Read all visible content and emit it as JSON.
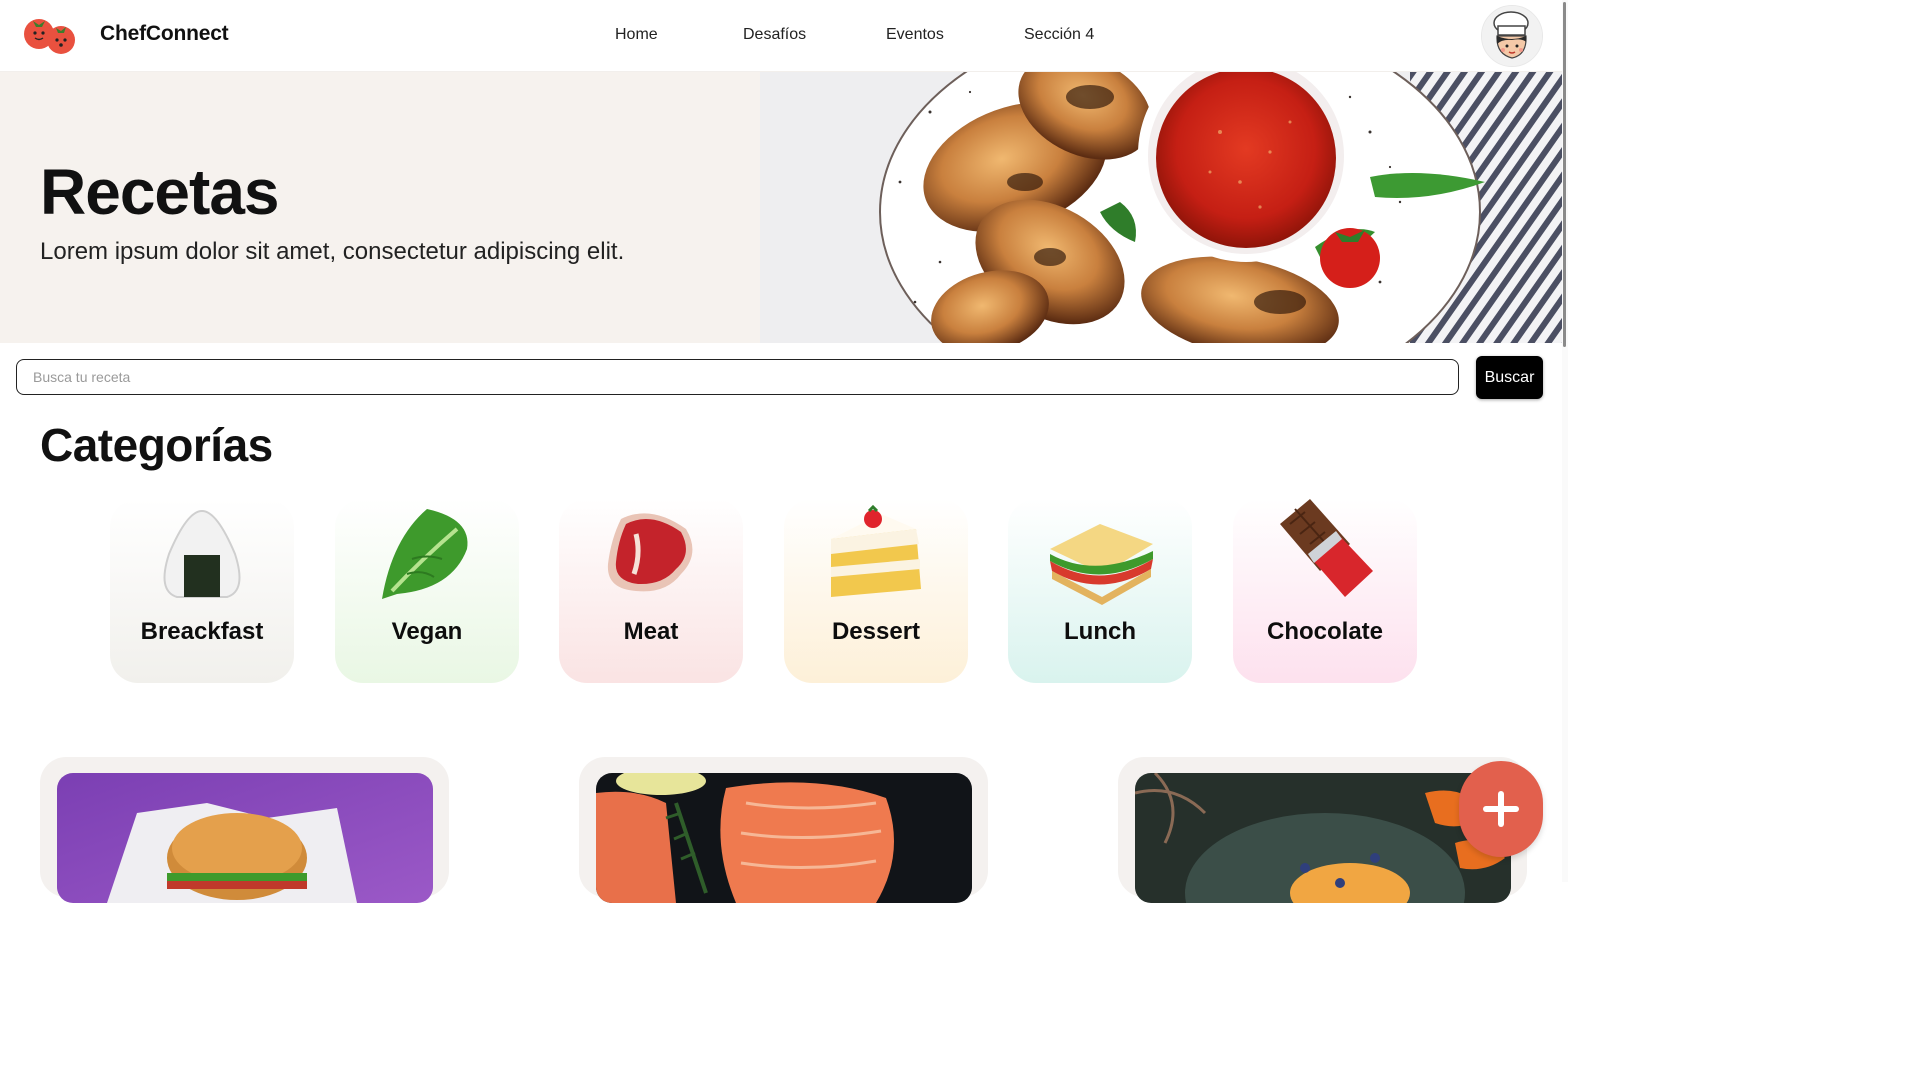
{
  "brand": {
    "name": "ChefConnect"
  },
  "nav": {
    "items": [
      {
        "label": "Home"
      },
      {
        "label": "Desafíos"
      },
      {
        "label": "Eventos"
      },
      {
        "label": "Sección 4"
      }
    ]
  },
  "hero": {
    "title": "Recetas",
    "subtitle": "Lorem ipsum dolor sit amet, consectetur adipiscing elit."
  },
  "search": {
    "placeholder": "Busca tu receta",
    "button_label": "Buscar"
  },
  "categories": {
    "title": "Categorías",
    "items": [
      {
        "label": "Breackfast",
        "icon": "onigiri-icon",
        "color": "#f1f0ec"
      },
      {
        "label": "Vegan",
        "icon": "leafy-green-icon",
        "color": "#e9f7e4"
      },
      {
        "label": "Meat",
        "icon": "steak-icon",
        "color": "#fae3e3"
      },
      {
        "label": "Dessert",
        "icon": "cake-slice-icon",
        "color": "#fdf0d8"
      },
      {
        "label": "Lunch",
        "icon": "sandwich-icon",
        "color": "#d9f3ee"
      },
      {
        "label": "Chocolate",
        "icon": "chocolate-bar-icon",
        "color": "#fde1ee"
      }
    ]
  },
  "recipes": [
    {
      "image": "burger-photo"
    },
    {
      "image": "salmon-photo"
    },
    {
      "image": "pancake-photo"
    }
  ],
  "colors": {
    "hero_bg": "#f6f2ee",
    "fab": "#e2604d",
    "button": "#000000"
  }
}
